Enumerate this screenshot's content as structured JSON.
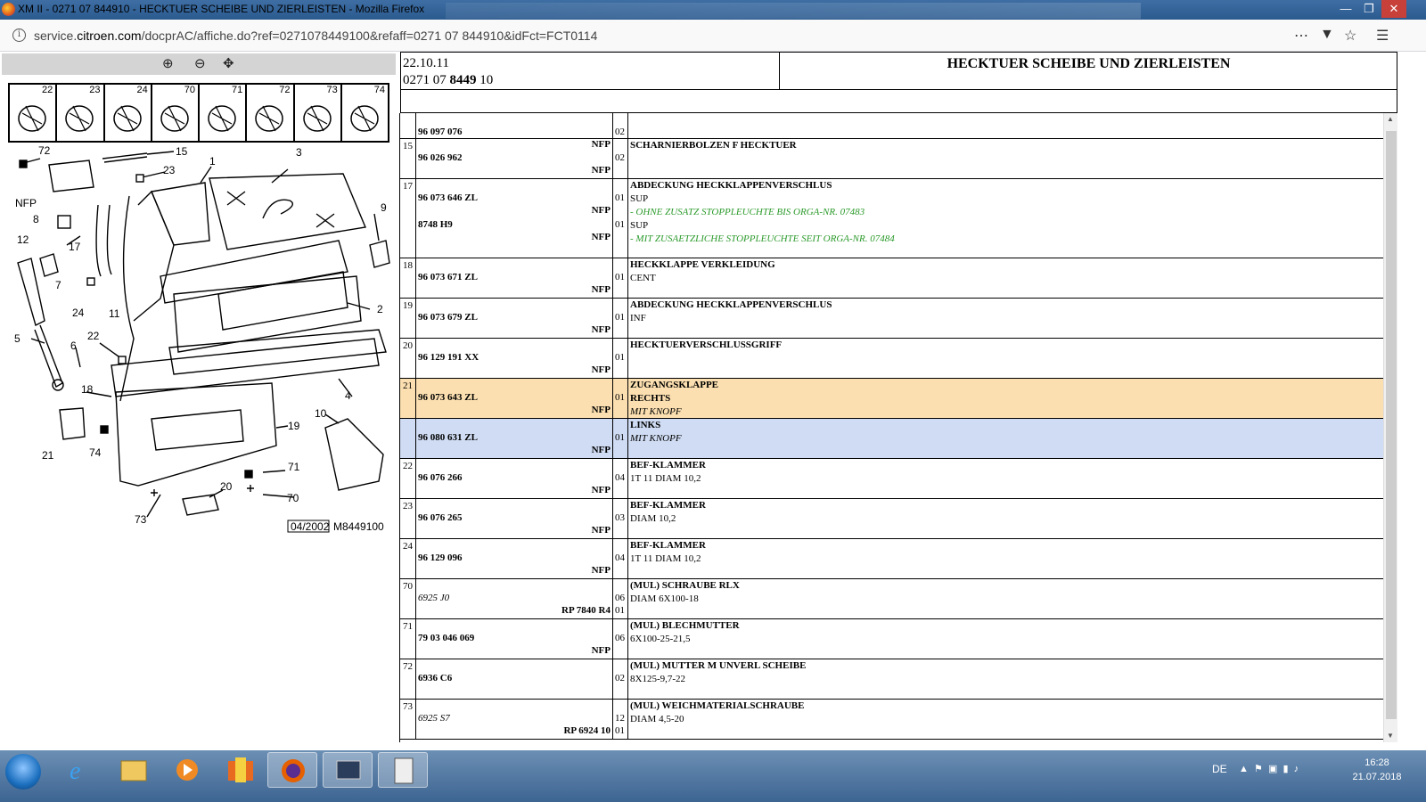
{
  "window": {
    "title": "XM II - 0271 07 844910 - HECKTUER SCHEIBE UND ZIERLEISTEN - Mozilla Firefox"
  },
  "urlbar": {
    "domain_pre": "service.",
    "domain_main": "citroen.com",
    "path": "/docprAC/affiche.do?ref=0271078449100&refaff=0271 07 844910&idFct=FCT0114"
  },
  "thumbs": [
    "22",
    "23",
    "24",
    "70",
    "71",
    "72",
    "73",
    "74"
  ],
  "diagram": {
    "labels": [
      "72",
      "15",
      "3",
      "NFP",
      "23",
      "1",
      "8",
      "9",
      "12",
      "17",
      "7",
      "24",
      "11",
      "2",
      "5",
      "6",
      "22",
      "18",
      "4",
      "10",
      "19",
      "21",
      "74",
      "71",
      "20",
      "70",
      "73"
    ],
    "stamp_date": "04/2002",
    "stamp_code": "M8449100"
  },
  "header": {
    "date": "22.10.11",
    "ref_pre": "0271 07 ",
    "ref_bold": "8449",
    "ref_post": " 10",
    "title": "HECKTUER SCHEIBE UND ZIERLEISTEN"
  },
  "rows": [
    {
      "no": "",
      "parts": [
        {
          "pn": "96 097 076",
          "tag": "NFP",
          "qty": "02"
        }
      ],
      "desc": []
    },
    {
      "no": "15",
      "parts": [
        {
          "pn": "96 026 962",
          "tag": "NFP",
          "qty": "02"
        }
      ],
      "desc": [
        {
          "t": "SCHARNIERBOLZEN F HECKTUER",
          "s": "b"
        }
      ]
    },
    {
      "no": "17",
      "parts": [
        {
          "pn": "96 073 646 ZL",
          "tag": "NFP",
          "qty": "01"
        },
        {
          "pn": "8748 H9",
          "tag": "NFP",
          "qty": "01"
        }
      ],
      "desc": [
        {
          "t": "ABDECKUNG HECKKLAPPENVERSCHLUS",
          "s": "b"
        },
        {
          "t": "SUP",
          "s": ""
        },
        {
          "t": "- OHNE ZUSATZ STOPPLEUCHTE BIS ORGA-NR. 07483",
          "s": "green"
        },
        {
          "t": "SUP",
          "s": ""
        },
        {
          "t": "- MIT ZUSAETZLICHE STOPPLEUCHTE SEIT ORGA-NR. 07484",
          "s": "green"
        }
      ]
    },
    {
      "no": "18",
      "parts": [
        {
          "pn": "96 073 671 ZL",
          "tag": "NFP",
          "qty": "01"
        }
      ],
      "desc": [
        {
          "t": "HECKKLAPPE VERKLEIDUNG",
          "s": "b"
        },
        {
          "t": "CENT",
          "s": ""
        }
      ]
    },
    {
      "no": "19",
      "parts": [
        {
          "pn": "96 073 679 ZL",
          "tag": "NFP",
          "qty": "01"
        }
      ],
      "desc": [
        {
          "t": "ABDECKUNG HECKKLAPPENVERSCHLUS",
          "s": "b"
        },
        {
          "t": "INF",
          "s": ""
        }
      ]
    },
    {
      "no": "20",
      "parts": [
        {
          "pn": "96 129 191 XX",
          "tag": "NFP",
          "qty": "01"
        }
      ],
      "desc": [
        {
          "t": "HECKTUERVERSCHLUSSGRIFF",
          "s": "b"
        }
      ]
    },
    {
      "no": "21",
      "parts": [
        {
          "pn": "96 073 643 ZL",
          "tag": "NFP",
          "qty": "01"
        }
      ],
      "desc": [
        {
          "t": "ZUGANGSKLAPPE",
          "s": "b"
        },
        {
          "t": "RECHTS",
          "s": "b"
        },
        {
          "t": "MIT KNOPF",
          "s": "it"
        }
      ],
      "hl": "hl1"
    },
    {
      "no": "",
      "parts": [
        {
          "pn": "96 080 631 ZL",
          "tag": "NFP",
          "qty": "01"
        }
      ],
      "desc": [
        {
          "t": "LINKS",
          "s": "b"
        },
        {
          "t": "MIT KNOPF",
          "s": "it"
        }
      ],
      "hl": "hl2"
    },
    {
      "no": "22",
      "parts": [
        {
          "pn": "96 076 266",
          "tag": "NFP",
          "qty": "04"
        }
      ],
      "desc": [
        {
          "t": "BEF-KLAMMER",
          "s": "b"
        },
        {
          "t": "1T 11 DIAM 10,2",
          "s": ""
        }
      ]
    },
    {
      "no": "23",
      "parts": [
        {
          "pn": "96 076 265",
          "tag": "NFP",
          "qty": "03"
        }
      ],
      "desc": [
        {
          "t": "BEF-KLAMMER",
          "s": "b"
        },
        {
          "t": "DIAM 10,2",
          "s": ""
        }
      ]
    },
    {
      "no": "24",
      "parts": [
        {
          "pn": "96 129 096",
          "tag": "NFP",
          "qty": "04"
        }
      ],
      "desc": [
        {
          "t": "BEF-KLAMMER",
          "s": "b"
        },
        {
          "t": "1T 11 DIAM 10,2",
          "s": ""
        }
      ]
    },
    {
      "no": "70",
      "parts": [
        {
          "pn": "6925 J0",
          "tag": "RP 7840 R4",
          "qty": "06",
          "qty2": "01",
          "it": true
        }
      ],
      "desc": [
        {
          "t": "(MUL) SCHRAUBE RLX",
          "s": "b"
        },
        {
          "t": "DIAM 6X100-18",
          "s": ""
        }
      ]
    },
    {
      "no": "71",
      "parts": [
        {
          "pn": "79 03 046 069",
          "tag": "NFP",
          "qty": "06"
        }
      ],
      "desc": [
        {
          "t": "(MUL) BLECHMUTTER",
          "s": "b"
        },
        {
          "t": "6X100-25-21,5",
          "s": ""
        }
      ]
    },
    {
      "no": "72",
      "parts": [
        {
          "pn": "6936 C6",
          "tag": "",
          "qty": "02"
        }
      ],
      "desc": [
        {
          "t": "(MUL) MUTTER M UNVERL SCHEIBE",
          "s": "b"
        },
        {
          "t": "8X125-9,7-22",
          "s": ""
        }
      ]
    },
    {
      "no": "73",
      "parts": [
        {
          "pn": "6925 S7",
          "tag": "RP 6924 10",
          "qty": "12",
          "qty2": "01",
          "it": true
        }
      ],
      "desc": [
        {
          "t": "(MUL) WEICHMATERIALSCHRAUBE",
          "s": "b"
        },
        {
          "t": "DIAM 4,5-20",
          "s": ""
        }
      ]
    }
  ],
  "taskbar": {
    "lang": "DE",
    "time": "16:28",
    "date": "21.07.2018"
  }
}
